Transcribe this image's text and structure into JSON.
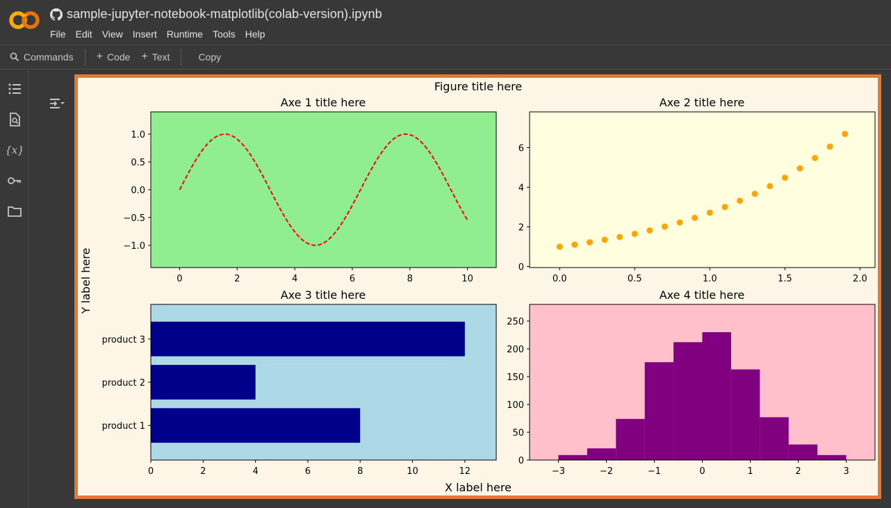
{
  "header": {
    "title": "sample-jupyter-notebook-matplotlib(colab-version).ipynb",
    "logo_text": "CO",
    "menu": [
      "File",
      "Edit",
      "View",
      "Insert",
      "Runtime",
      "Tools",
      "Help"
    ]
  },
  "toolbar": {
    "commands_label": "Commands",
    "code_label": "Code",
    "text_label": "Text",
    "copy_label": "Copy"
  },
  "rail": {
    "icons": [
      "table-of-contents-icon",
      "find-icon",
      "variables-icon",
      "secrets-key-icon",
      "files-folder-icon"
    ]
  },
  "colors": {
    "accent_border": "#e37933",
    "figure_bg": "#fdf5e6",
    "ax1_bg": "#90ee90",
    "ax2_bg": "#ffffe0",
    "ax3_bg": "#add8e6",
    "ax4_bg": "#ffc0cb",
    "sine_line": "#ff0000",
    "scatter": "#ffa500",
    "bars": "#00008b",
    "hist": "#800080"
  },
  "chart_data": [
    {
      "type": "line",
      "figure_title": "Figure title here",
      "figure_xlabel": "X label here",
      "figure_ylabel": "Y label here",
      "title": "Axe 1 title here",
      "function": "sin(x)",
      "x_range": [
        0,
        10
      ],
      "line_style": "dashed",
      "xlim": [
        -1,
        11
      ],
      "ylim": [
        -1.4,
        1.4
      ],
      "xticks": [
        0,
        2,
        4,
        6,
        8,
        10
      ],
      "yticks": [
        1.0,
        0.5,
        0.0,
        -0.5,
        -1.0
      ],
      "ytick_labels": [
        "1.0",
        "0.5",
        "0.0",
        "−0.5",
        "−1.0"
      ]
    },
    {
      "type": "scatter",
      "title": "Axe 2 title here",
      "function": "exp(x)",
      "x_start": 0.0,
      "x_stop": 2.0,
      "x_step": 0.1,
      "xlim": [
        -0.2,
        2.1
      ],
      "ylim": [
        -0.05,
        7.8
      ],
      "xticks": [
        0.0,
        0.5,
        1.0,
        1.5,
        2.0
      ],
      "xtick_labels": [
        "0.0",
        "0.5",
        "1.0",
        "1.5",
        "2.0"
      ],
      "yticks": [
        0,
        2,
        4,
        6
      ]
    },
    {
      "type": "bar",
      "orientation": "horizontal",
      "title": "Axe 3 title here",
      "categories": [
        "product 1",
        "product 2",
        "product 3"
      ],
      "values": [
        8,
        4,
        12
      ],
      "xlim": [
        0,
        13.2
      ],
      "xticks": [
        0,
        2,
        4,
        6,
        8,
        10,
        12
      ]
    },
    {
      "type": "bar",
      "subtype": "histogram",
      "title": "Axe 4 title here",
      "bin_edges": [
        -3.0,
        -2.4,
        -1.8,
        -1.2,
        -0.6,
        0.0,
        0.6,
        1.2,
        1.8,
        2.4,
        3.0
      ],
      "counts": [
        9,
        21,
        74,
        176,
        212,
        230,
        163,
        77,
        28,
        9
      ],
      "xlim": [
        -3.6,
        3.6
      ],
      "ylim": [
        0,
        280
      ],
      "xticks": [
        -3,
        -2,
        -1,
        0,
        1,
        2,
        3
      ],
      "xtick_labels": [
        "−3",
        "−2",
        "−1",
        "0",
        "1",
        "2",
        "3"
      ],
      "yticks": [
        0,
        50,
        100,
        150,
        200,
        250
      ]
    }
  ]
}
